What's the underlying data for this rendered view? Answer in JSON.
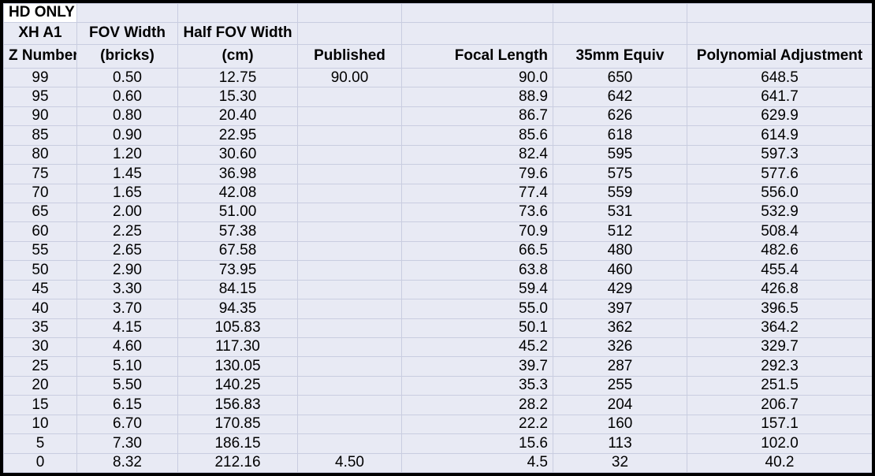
{
  "sheet": {
    "corner_label": "HD ONLY",
    "colors": {
      "cell_fill": "#e8eaf4",
      "grid_line": "#c9cde0",
      "outer_border": "#000000",
      "corner_fill": "#ffffff",
      "text": "#000000"
    },
    "header_rows": [
      [
        "HD ONLY",
        "",
        "",
        "",
        "",
        "",
        ""
      ],
      [
        "XH A1",
        "FOV Width",
        "Half FOV Width",
        "",
        "",
        "",
        ""
      ],
      [
        "Z Number",
        "(bricks)",
        "(cm)",
        "Published",
        "Focal Length",
        "35mm Equiv",
        "Polynomial Adjustment"
      ]
    ],
    "columns": [
      {
        "key": "z_number",
        "title_line1": "XH A1",
        "title_line2": "Z Number",
        "align": "center"
      },
      {
        "key": "fov_width_bricks",
        "title_line1": "FOV Width",
        "title_line2": "(bricks)",
        "align": "center"
      },
      {
        "key": "half_fov_width_cm",
        "title_line1": "Half FOV Width",
        "title_line2": "(cm)",
        "align": "center"
      },
      {
        "key": "published",
        "title_line1": "",
        "title_line2": "Published",
        "align": "center"
      },
      {
        "key": "focal_length",
        "title_line1": "",
        "title_line2": "Focal Length",
        "align": "right"
      },
      {
        "key": "equiv_35mm",
        "title_line1": "",
        "title_line2": "35mm Equiv",
        "align": "center"
      },
      {
        "key": "polynomial_adjustment",
        "title_line1": "",
        "title_line2": "Polynomial Adjustment",
        "align": "center"
      }
    ],
    "rows": [
      {
        "z_number": "99",
        "fov_width_bricks": "0.50",
        "half_fov_width_cm": "12.75",
        "published": "90.00",
        "focal_length": "90.0",
        "equiv_35mm": "650",
        "polynomial_adjustment": "648.5"
      },
      {
        "z_number": "95",
        "fov_width_bricks": "0.60",
        "half_fov_width_cm": "15.30",
        "published": "",
        "focal_length": "88.9",
        "equiv_35mm": "642",
        "polynomial_adjustment": "641.7"
      },
      {
        "z_number": "90",
        "fov_width_bricks": "0.80",
        "half_fov_width_cm": "20.40",
        "published": "",
        "focal_length": "86.7",
        "equiv_35mm": "626",
        "polynomial_adjustment": "629.9"
      },
      {
        "z_number": "85",
        "fov_width_bricks": "0.90",
        "half_fov_width_cm": "22.95",
        "published": "",
        "focal_length": "85.6",
        "equiv_35mm": "618",
        "polynomial_adjustment": "614.9"
      },
      {
        "z_number": "80",
        "fov_width_bricks": "1.20",
        "half_fov_width_cm": "30.60",
        "published": "",
        "focal_length": "82.4",
        "equiv_35mm": "595",
        "polynomial_adjustment": "597.3"
      },
      {
        "z_number": "75",
        "fov_width_bricks": "1.45",
        "half_fov_width_cm": "36.98",
        "published": "",
        "focal_length": "79.6",
        "equiv_35mm": "575",
        "polynomial_adjustment": "577.6"
      },
      {
        "z_number": "70",
        "fov_width_bricks": "1.65",
        "half_fov_width_cm": "42.08",
        "published": "",
        "focal_length": "77.4",
        "equiv_35mm": "559",
        "polynomial_adjustment": "556.0"
      },
      {
        "z_number": "65",
        "fov_width_bricks": "2.00",
        "half_fov_width_cm": "51.00",
        "published": "",
        "focal_length": "73.6",
        "equiv_35mm": "531",
        "polynomial_adjustment": "532.9"
      },
      {
        "z_number": "60",
        "fov_width_bricks": "2.25",
        "half_fov_width_cm": "57.38",
        "published": "",
        "focal_length": "70.9",
        "equiv_35mm": "512",
        "polynomial_adjustment": "508.4"
      },
      {
        "z_number": "55",
        "fov_width_bricks": "2.65",
        "half_fov_width_cm": "67.58",
        "published": "",
        "focal_length": "66.5",
        "equiv_35mm": "480",
        "polynomial_adjustment": "482.6"
      },
      {
        "z_number": "50",
        "fov_width_bricks": "2.90",
        "half_fov_width_cm": "73.95",
        "published": "",
        "focal_length": "63.8",
        "equiv_35mm": "460",
        "polynomial_adjustment": "455.4"
      },
      {
        "z_number": "45",
        "fov_width_bricks": "3.30",
        "half_fov_width_cm": "84.15",
        "published": "",
        "focal_length": "59.4",
        "equiv_35mm": "429",
        "polynomial_adjustment": "426.8"
      },
      {
        "z_number": "40",
        "fov_width_bricks": "3.70",
        "half_fov_width_cm": "94.35",
        "published": "",
        "focal_length": "55.0",
        "equiv_35mm": "397",
        "polynomial_adjustment": "396.5"
      },
      {
        "z_number": "35",
        "fov_width_bricks": "4.15",
        "half_fov_width_cm": "105.83",
        "published": "",
        "focal_length": "50.1",
        "equiv_35mm": "362",
        "polynomial_adjustment": "364.2"
      },
      {
        "z_number": "30",
        "fov_width_bricks": "4.60",
        "half_fov_width_cm": "117.30",
        "published": "",
        "focal_length": "45.2",
        "equiv_35mm": "326",
        "polynomial_adjustment": "329.7"
      },
      {
        "z_number": "25",
        "fov_width_bricks": "5.10",
        "half_fov_width_cm": "130.05",
        "published": "",
        "focal_length": "39.7",
        "equiv_35mm": "287",
        "polynomial_adjustment": "292.3"
      },
      {
        "z_number": "20",
        "fov_width_bricks": "5.50",
        "half_fov_width_cm": "140.25",
        "published": "",
        "focal_length": "35.3",
        "equiv_35mm": "255",
        "polynomial_adjustment": "251.5"
      },
      {
        "z_number": "15",
        "fov_width_bricks": "6.15",
        "half_fov_width_cm": "156.83",
        "published": "",
        "focal_length": "28.2",
        "equiv_35mm": "204",
        "polynomial_adjustment": "206.7"
      },
      {
        "z_number": "10",
        "fov_width_bricks": "6.70",
        "half_fov_width_cm": "170.85",
        "published": "",
        "focal_length": "22.2",
        "equiv_35mm": "160",
        "polynomial_adjustment": "157.1"
      },
      {
        "z_number": "5",
        "fov_width_bricks": "7.30",
        "half_fov_width_cm": "186.15",
        "published": "",
        "focal_length": "15.6",
        "equiv_35mm": "113",
        "polynomial_adjustment": "102.0"
      },
      {
        "z_number": "0",
        "fov_width_bricks": "8.32",
        "half_fov_width_cm": "212.16",
        "published": "4.50",
        "focal_length": "4.5",
        "equiv_35mm": "32",
        "polynomial_adjustment": "40.2"
      }
    ]
  }
}
